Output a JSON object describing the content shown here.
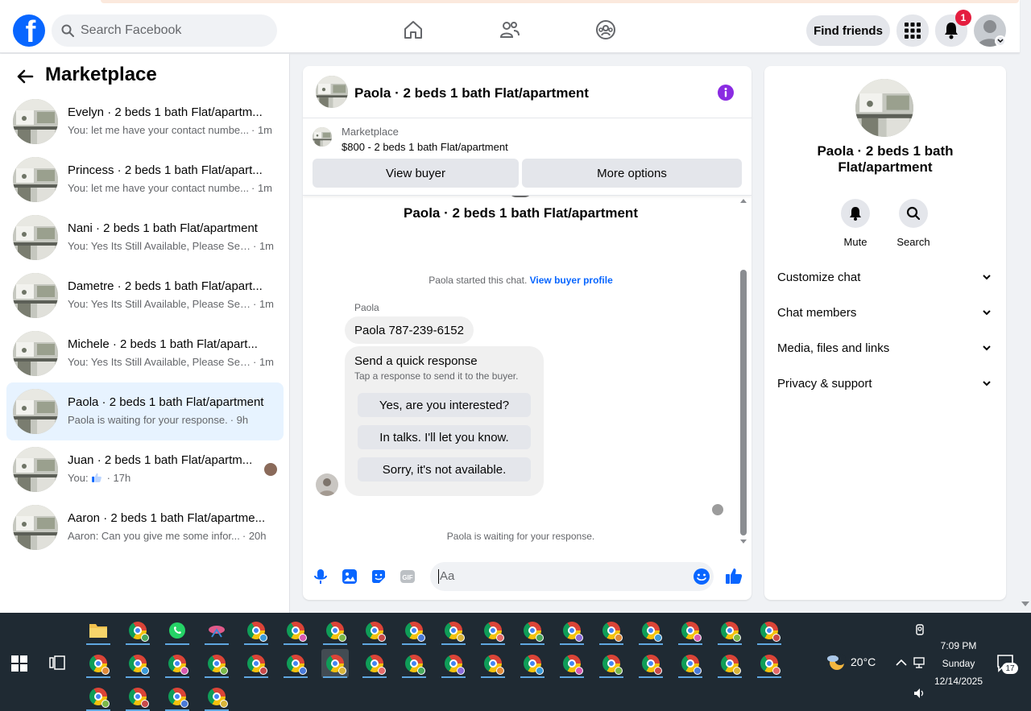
{
  "topbar": {
    "search_placeholder": "Search Facebook",
    "find_friends": "Find friends",
    "notification_count": "1"
  },
  "sidebar": {
    "title": "Marketplace",
    "conversations": [
      {
        "title": "Evelyn · 2 beds 1 bath Flat/apartm...",
        "snippet": "You: let me have your contact numbe...",
        "time": "· 1m"
      },
      {
        "title": "Princess · 2 beds 1 bath Flat/apart...",
        "snippet": "You: let me have your contact numbe...",
        "time": "· 1m"
      },
      {
        "title": "Nani · 2 beds 1 bath Flat/apartment",
        "snippet": "You: Yes Its Still Available, Please Sen...",
        "time": "· 1m"
      },
      {
        "title": "Dametre · 2 beds 1 bath Flat/apart...",
        "snippet": "You: Yes Its Still Available, Please Sen...",
        "time": "· 1m"
      },
      {
        "title": "Michele · 2 beds 1 bath Flat/apart...",
        "snippet": "You: Yes Its Still Available, Please Sen...",
        "time": "· 1m"
      },
      {
        "title": "Paola · 2 beds 1 bath Flat/apartment",
        "snippet": "Paola is waiting for your response.",
        "time": "· 9h"
      },
      {
        "title": "Juan · 2 beds 1 bath Flat/apartm...",
        "snippet": "You: ",
        "time": "· 17h"
      },
      {
        "title": "Aaron · 2 beds 1 bath Flat/apartme...",
        "snippet": "Aaron: Can you give me some infor...",
        "time": "· 20h"
      }
    ]
  },
  "chat": {
    "header_title": "Paola · 2 beds 1 bath Flat/apartment",
    "marketplace_label": "Marketplace",
    "listing": "$800 - 2 beds 1 bath Flat/apartment",
    "view_buyer": "View buyer",
    "more_options": "More options",
    "center_title": "Paola · 2 beds 1 bath Flat/apartment",
    "started_text": "Paola started this chat.",
    "view_buyer_profile": "View buyer profile",
    "sender_name": "Paola",
    "message": "Paola 787-239-6152",
    "quick_title": "Send a quick response",
    "quick_sub": "Tap a response to send it to the buyer.",
    "quick_options": [
      "Yes, are you interested?",
      "In talks. I'll let you know.",
      "Sorry, it's not available."
    ],
    "waiting": "Paola is waiting for your response.",
    "input_placeholder": "Aa"
  },
  "info": {
    "name": "Paola · 2 beds 1 bath Flat/apartment",
    "mute": "Mute",
    "search": "Search",
    "sections": [
      "Customize chat",
      "Chat members",
      "Media, files and links",
      "Privacy & support"
    ]
  },
  "taskbar": {
    "temperature": "20°C",
    "time": "7:09 PM",
    "day": "Sunday",
    "date": "12/14/2025",
    "notification_count": "17"
  },
  "colors": {
    "facebook_blue": "#0866ff",
    "active_row": "#e7f3ff",
    "badge_red": "#e41e3f",
    "info_purple": "#8a2be2"
  }
}
